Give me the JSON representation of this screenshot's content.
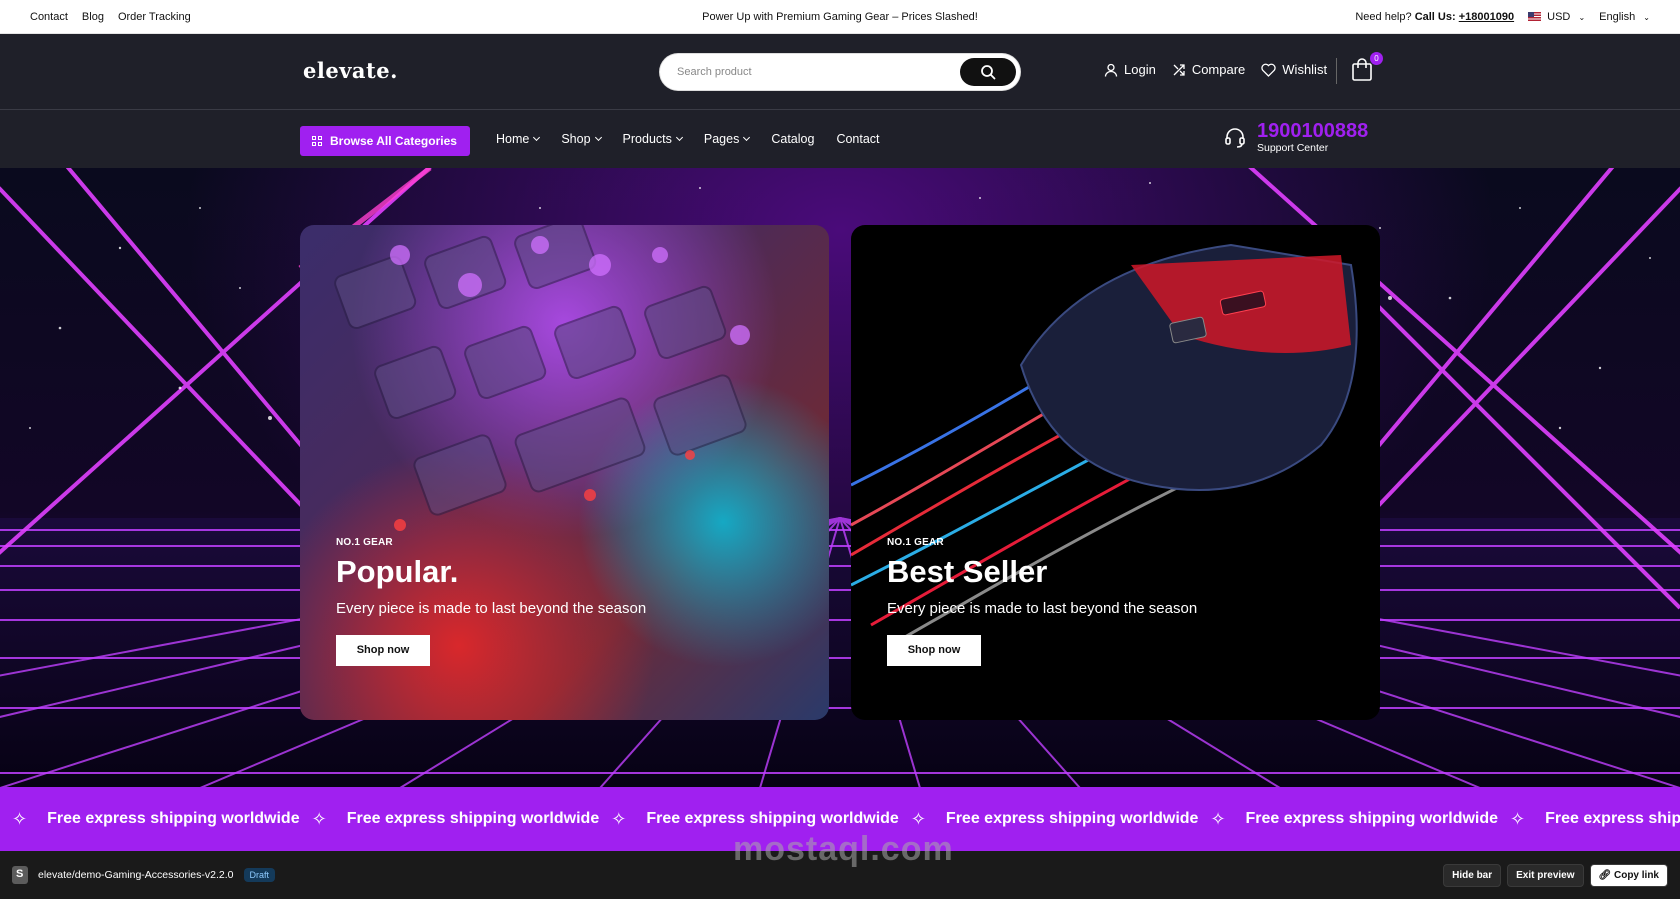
{
  "topbar": {
    "links": [
      "Contact",
      "Blog",
      "Order Tracking"
    ],
    "announcement": "Power Up with Premium Gaming Gear – Prices Slashed!",
    "help_prefix": "Need help?",
    "call_label": "Call Us:",
    "phone": "+18001090",
    "currency": "USD",
    "language": "English"
  },
  "header": {
    "logo": "elevate.",
    "search_placeholder": "Search product",
    "login": "Login",
    "compare": "Compare",
    "wishlist": "Wishlist",
    "cart_count": "0"
  },
  "nav": {
    "browse": "Browse All Categories",
    "items": [
      {
        "label": "Home",
        "dropdown": true
      },
      {
        "label": "Shop",
        "dropdown": true
      },
      {
        "label": "Products",
        "dropdown": true
      },
      {
        "label": "Pages",
        "dropdown": true
      },
      {
        "label": "Catalog",
        "dropdown": false
      },
      {
        "label": "Contact",
        "dropdown": false
      }
    ],
    "support_number": "1900100888",
    "support_label": "Support Center"
  },
  "hero": {
    "cards": [
      {
        "eyebrow": "NO.1 GEAR",
        "title": "Popular.",
        "desc": "Every piece is made to last beyond the season",
        "button": "Shop now"
      },
      {
        "eyebrow": "NO.1 GEAR",
        "title": "Best Seller",
        "desc": "Every piece is made to last beyond the season",
        "button": "Shop now"
      }
    ]
  },
  "marquee": {
    "text": "Free express shipping worldwide",
    "repeat_visible": 6
  },
  "bottombar": {
    "theme": "elevate/demo-Gaming-Accessories-v2.2.0",
    "status": "Draft",
    "hide": "Hide bar",
    "exit": "Exit preview",
    "copy": "Copy link"
  },
  "watermark": "mostaql.com",
  "colors": {
    "accent": "#a020f0",
    "header_bg": "#1f2029"
  }
}
